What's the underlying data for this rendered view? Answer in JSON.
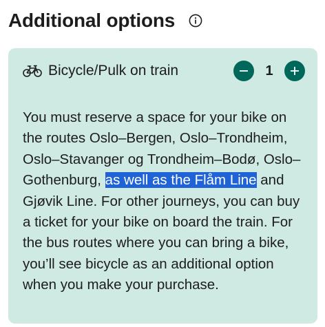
{
  "header": {
    "title": "Additional options",
    "info_icon": "info-circle-icon"
  },
  "option": {
    "icon": "bicycle-icon",
    "label": "Bicycle/Pulk on train",
    "quantity": "1",
    "decrement_icon": "minus-icon",
    "increment_icon": "plus-icon",
    "accent_color": "#00685a",
    "card_color": "#cfe9e3"
  },
  "description": {
    "part1": "You must reserve a space for your bike on the routes Oslo–Bergen, Oslo–Trondheim, Oslo–Stavanger og Trondheim–Bodø, Oslo–Gothenburg, ",
    "highlighted": "as well as the Flåm Line",
    "part2": " and Gjøvik Line. For other journeys, you can buy a ticket for your bike on board the train. For the bus routes where you can bring a bike, you’ll see bicycle as an additional option when you make your purchase.",
    "highlight_color": "#1f63d6"
  }
}
